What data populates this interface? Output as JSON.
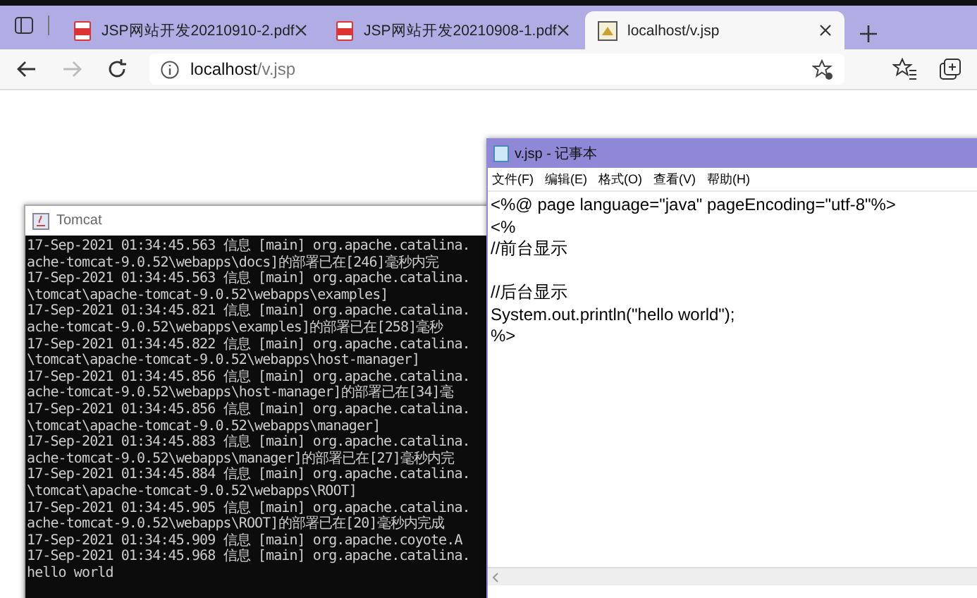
{
  "browser": {
    "tabs": [
      {
        "title": "JSP网站开发20210910-2.pdf",
        "kind": "pdf",
        "selected": false
      },
      {
        "title": "JSP网站开发20210908-1.pdf",
        "kind": "pdf",
        "selected": false
      },
      {
        "title": "localhost/v.jsp",
        "kind": "page",
        "selected": true
      }
    ],
    "address": {
      "host": "localhost",
      "path": "/v.jsp"
    }
  },
  "console_window": {
    "title": "Tomcat",
    "lines": [
      "17-Sep-2021 01:34:45.563 信息 [main] org.apache.catalina.",
      "ache-tomcat-9.0.52\\webapps\\docs]的部署已在[246]毫秒内完",
      "17-Sep-2021 01:34:45.563 信息 [main] org.apache.catalina.",
      "\\tomcat\\apache-tomcat-9.0.52\\webapps\\examples]",
      "17-Sep-2021 01:34:45.821 信息 [main] org.apache.catalina.",
      "ache-tomcat-9.0.52\\webapps\\examples]的部署已在[258]毫秒",
      "17-Sep-2021 01:34:45.822 信息 [main] org.apache.catalina.",
      "\\tomcat\\apache-tomcat-9.0.52\\webapps\\host-manager]",
      "17-Sep-2021 01:34:45.856 信息 [main] org.apache.catalina.",
      "ache-tomcat-9.0.52\\webapps\\host-manager]的部署已在[34]毫",
      "17-Sep-2021 01:34:45.856 信息 [main] org.apache.catalina.",
      "\\tomcat\\apache-tomcat-9.0.52\\webapps\\manager]",
      "17-Sep-2021 01:34:45.883 信息 [main] org.apache.catalina.",
      "ache-tomcat-9.0.52\\webapps\\manager]的部署已在[27]毫秒内完",
      "17-Sep-2021 01:34:45.884 信息 [main] org.apache.catalina.",
      "\\tomcat\\apache-tomcat-9.0.52\\webapps\\ROOT]",
      "17-Sep-2021 01:34:45.905 信息 [main] org.apache.catalina.",
      "ache-tomcat-9.0.52\\webapps\\ROOT]的部署已在[20]毫秒内完成",
      "17-Sep-2021 01:34:45.909 信息 [main] org.apache.coyote.A",
      "17-Sep-2021 01:34:45.968 信息 [main] org.apache.catalina.",
      "hello world"
    ]
  },
  "notepad_window": {
    "title": "v.jsp - 记事本",
    "menu": [
      "文件(F)",
      "编辑(E)",
      "格式(O)",
      "查看(V)",
      "帮助(H)"
    ],
    "paragraphs": [
      [
        "<%@ page language=\"java\" pageEncoding=\"utf-8\"%>",
        "<%",
        "//前台显示"
      ],
      [
        "//后台显示",
        "System.out.println(\"hello world\");",
        "%>"
      ]
    ]
  }
}
